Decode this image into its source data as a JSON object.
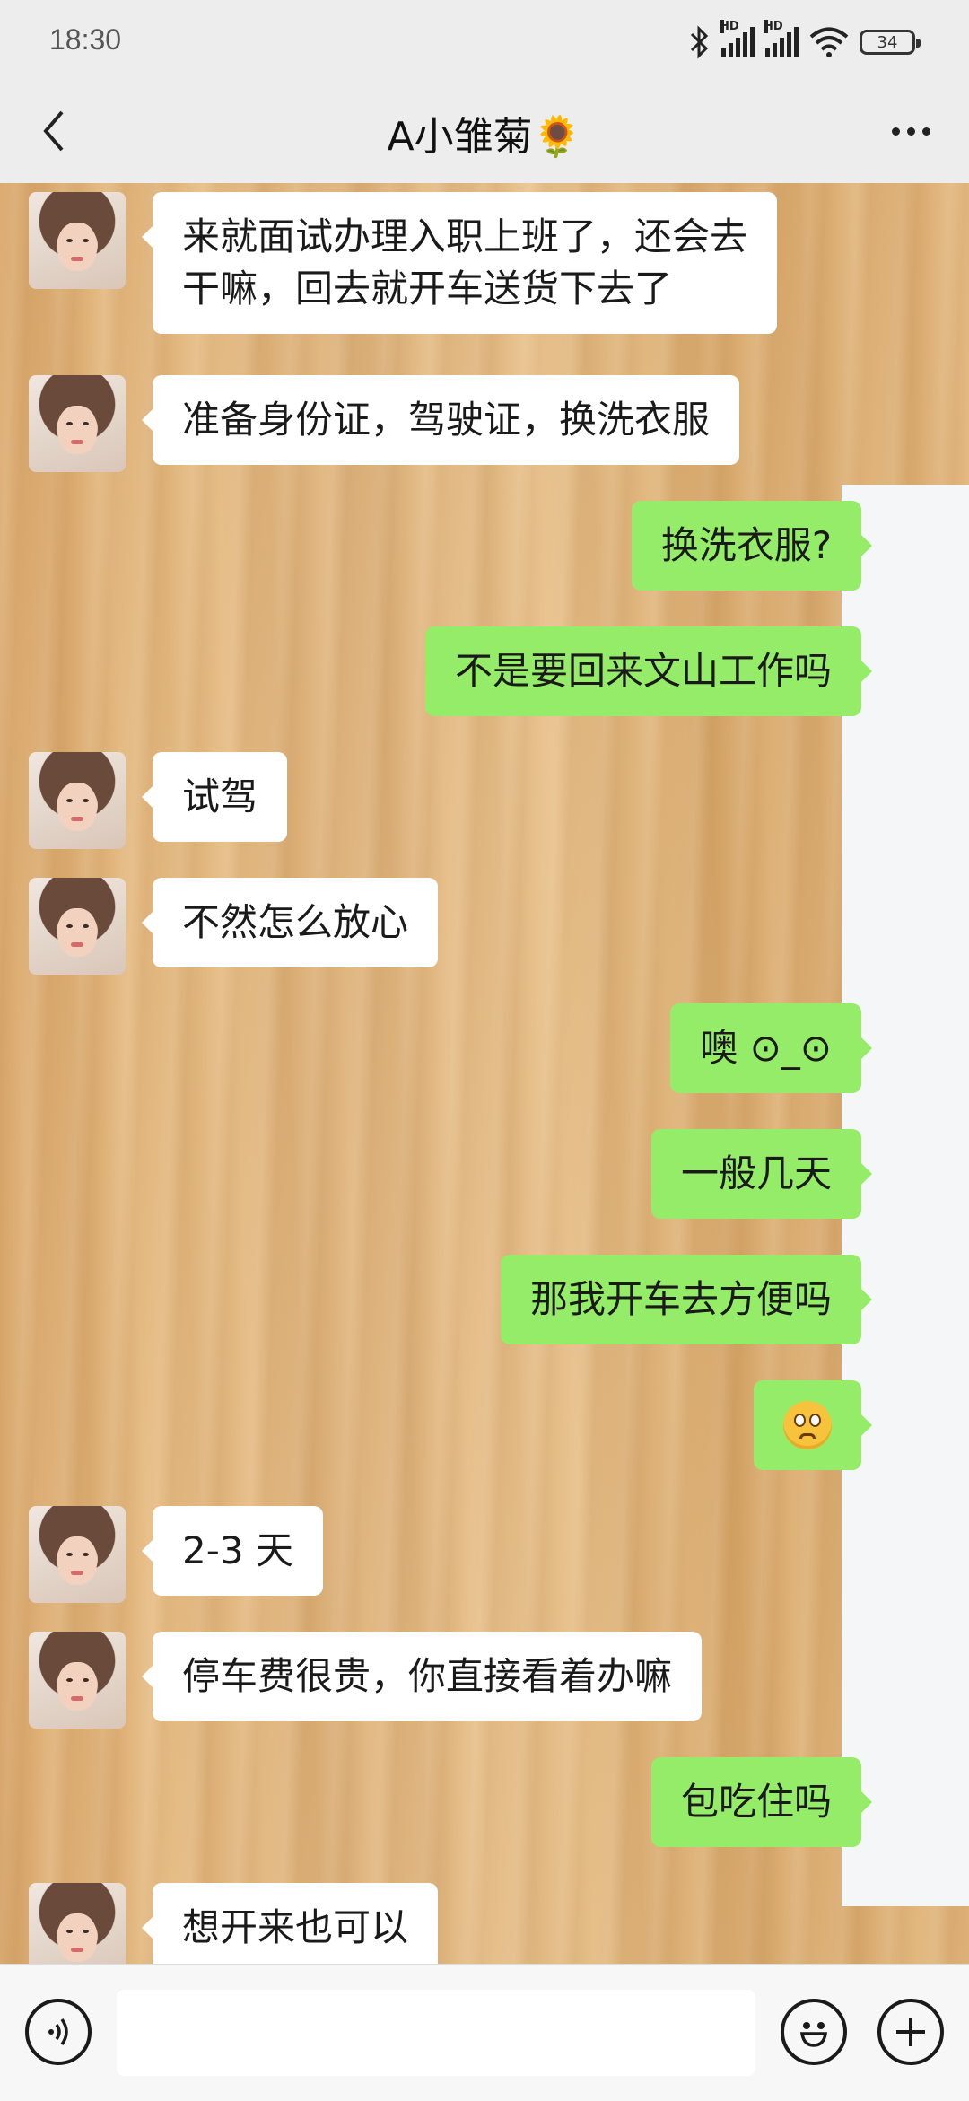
{
  "status": {
    "time": "18:30",
    "signal1_label": "HD",
    "signal2_label": "HD",
    "battery": "34"
  },
  "nav": {
    "title": "A小雏菊🌻"
  },
  "messages": [
    {
      "side": "left",
      "lines": [
        "来就面试办理入职上班了，还会去",
        "干嘛，回去就开车送货下去了"
      ]
    },
    {
      "side": "left",
      "lines": [
        "准备身份证，驾驶证，换洗衣服"
      ]
    },
    {
      "side": "right",
      "lines": [
        "换洗衣服?"
      ]
    },
    {
      "side": "right",
      "lines": [
        "不是要回来文山工作吗"
      ]
    },
    {
      "side": "left",
      "lines": [
        "试驾"
      ]
    },
    {
      "side": "left",
      "lines": [
        "不然怎么放心"
      ]
    },
    {
      "side": "right",
      "lines": [
        "噢 ⊙_⊙"
      ]
    },
    {
      "side": "right",
      "lines": [
        "一般几天"
      ]
    },
    {
      "side": "right",
      "lines": [
        "那我开车去方便吗"
      ]
    },
    {
      "side": "right",
      "emoji": "pleading-face-emoji"
    },
    {
      "side": "left",
      "lines": [
        "2-3 天"
      ]
    },
    {
      "side": "left",
      "lines": [
        "停车费很贵，你直接看着办嘛"
      ]
    },
    {
      "side": "right",
      "lines": [
        "包吃住吗"
      ]
    },
    {
      "side": "left",
      "lines": [
        "想开来也可以"
      ]
    }
  ],
  "input": {
    "value": "",
    "placeholder": ""
  },
  "icons": {
    "back": "chevron-left-icon",
    "more": "more-dots-icon",
    "voice": "voice-icon",
    "emoji": "emoji-icon",
    "plus": "plus-icon"
  },
  "colors": {
    "sent_bubble": "#95ec69",
    "received_bubble": "#ffffff",
    "bar_background": "#ededed"
  }
}
